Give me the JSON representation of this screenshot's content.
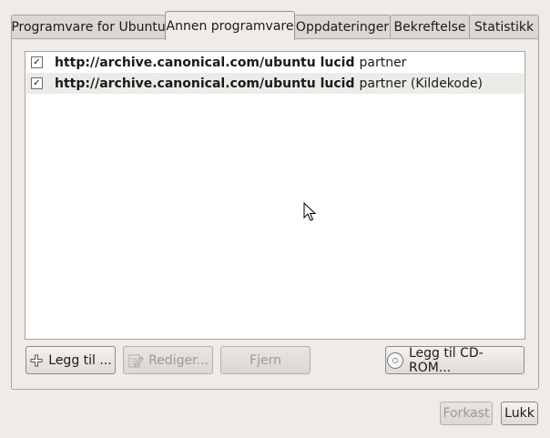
{
  "tabs": [
    {
      "label": "Programvare for Ubuntu",
      "active": false
    },
    {
      "label": "Annen programvare",
      "active": true
    },
    {
      "label": "Oppdateringer",
      "active": false
    },
    {
      "label": "Bekreftelse",
      "active": false
    },
    {
      "label": "Statistikk",
      "active": false
    }
  ],
  "sources": [
    {
      "checked": true,
      "url": "http://archive.canonical.com/ubuntu lucid",
      "component": "partner"
    },
    {
      "checked": true,
      "url": "http://archive.canonical.com/ubuntu lucid",
      "component": "partner (Kildekode)"
    }
  ],
  "buttons": {
    "add": "Legg til ...",
    "edit": "Rediger...",
    "remove": "Fjern",
    "add_cdrom": "Legg til CD-ROM..."
  },
  "footer": {
    "revert": "Forkast",
    "close": "Lukk"
  },
  "check_glyph": "✓",
  "icons": {
    "add": "plus-icon",
    "edit": "edit-icon",
    "cdrom": "cdrom-icon"
  }
}
